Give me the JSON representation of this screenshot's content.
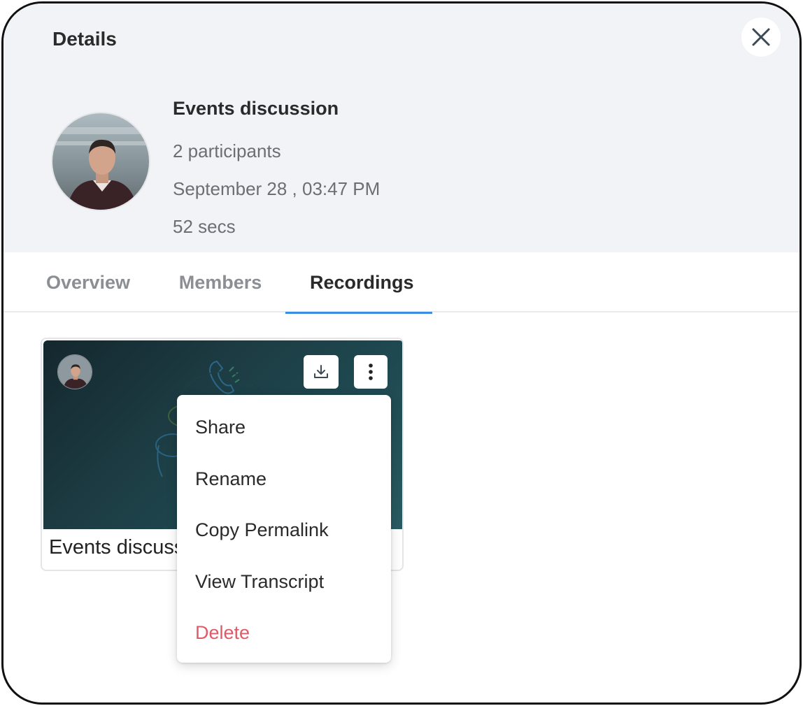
{
  "dialog": {
    "title": "Details"
  },
  "conversation": {
    "name": "Events discussion",
    "participants": "2 participants",
    "datetime": "September 28 , 03:47 PM",
    "duration": "52 secs"
  },
  "tabs": [
    {
      "label": "Overview",
      "active": false
    },
    {
      "label": "Members",
      "active": false
    },
    {
      "label": "Recordings",
      "active": true
    }
  ],
  "recording": {
    "title": "Events discuss"
  },
  "menu": {
    "items": [
      {
        "label": "Share"
      },
      {
        "label": "Rename"
      },
      {
        "label": "Copy Permalink"
      },
      {
        "label": "View Transcript"
      },
      {
        "label": "Delete",
        "color": "#de5b67"
      }
    ]
  },
  "icons": {
    "close": "close-icon",
    "download": "download-icon",
    "more": "more-vertical-icon",
    "phone": "phone-icon"
  },
  "colors": {
    "header_bg": "#f2f3f7",
    "active_tab_underline": "#3b8fe0",
    "danger": "#de5b67"
  }
}
